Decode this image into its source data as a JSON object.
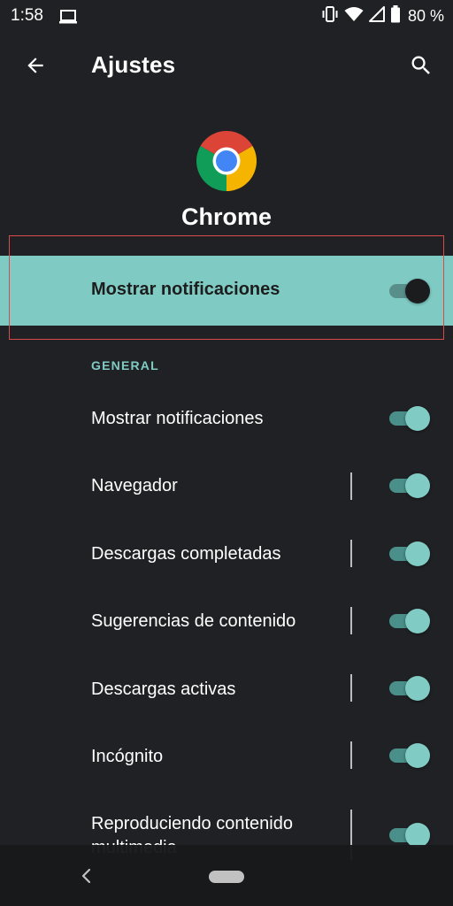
{
  "status_bar": {
    "time": "1:58",
    "battery": "80 %",
    "icons": [
      "laptop-icon",
      "vibrate-icon",
      "wifi-icon",
      "signal-icon",
      "battery-icon"
    ]
  },
  "app_bar": {
    "title": "Ajustes",
    "back_icon": "arrow-left-icon",
    "search_icon": "search-icon"
  },
  "app": {
    "name": "Chrome",
    "icon": "chrome-logo-icon"
  },
  "master": {
    "label": "Mostrar notificaciones",
    "enabled": true
  },
  "section": {
    "header": "GENERAL"
  },
  "items": [
    {
      "label": "Mostrar notificaciones",
      "enabled": true,
      "divider": false
    },
    {
      "label": "Navegador",
      "enabled": true,
      "divider": true
    },
    {
      "label": "Descargas completadas",
      "enabled": true,
      "divider": true
    },
    {
      "label": "Sugerencias de contenido",
      "enabled": true,
      "divider": true
    },
    {
      "label": "Descargas activas",
      "enabled": true,
      "divider": true
    },
    {
      "label": "Incógnito",
      "enabled": true,
      "divider": true
    },
    {
      "label_line1": "Reproduciendo contenido",
      "label_line2": "multimedia",
      "enabled": true,
      "divider": true
    }
  ],
  "nav_bar": {
    "back_icon": "nav-back-icon",
    "home_icon": "home-pill-icon"
  },
  "colors": {
    "background": "#202124",
    "accent": "#80cbc4",
    "highlight_border": "#d94a4a"
  }
}
